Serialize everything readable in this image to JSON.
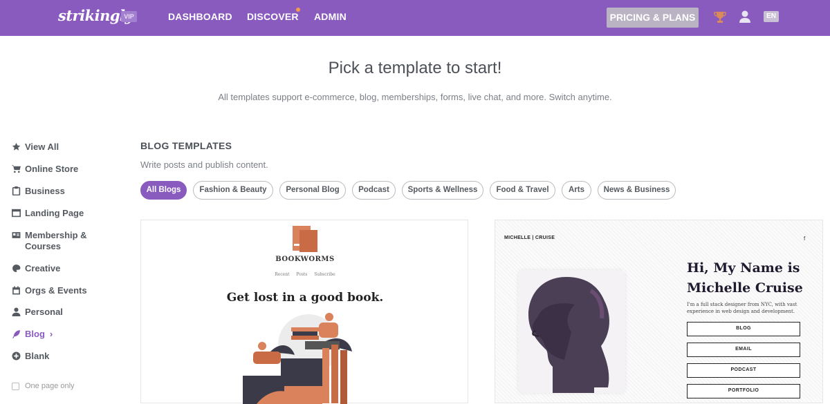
{
  "topbar": {
    "logo": "strikingly",
    "vip": "VIP",
    "nav": [
      "DASHBOARD",
      "DISCOVER",
      "ADMIN"
    ],
    "pricing": "PRICING & PLANS",
    "lang": "EN",
    "accent_color": "#8a5bbf"
  },
  "header": {
    "title": "Pick a template to start!",
    "subtitle": "All templates support e-commerce, blog, memberships, forms, live chat, and more. Switch anytime."
  },
  "sidebar": {
    "items": [
      {
        "label": "View All",
        "icon": "star-icon"
      },
      {
        "label": "Online Store",
        "icon": "cart-icon"
      },
      {
        "label": "Business",
        "icon": "clipboard-icon"
      },
      {
        "label": "Landing Page",
        "icon": "browser-icon"
      },
      {
        "label": "Membership & Courses",
        "icon": "id-card-icon"
      },
      {
        "label": "Creative",
        "icon": "palette-icon"
      },
      {
        "label": "Orgs & Events",
        "icon": "calendar-icon"
      },
      {
        "label": "Personal",
        "icon": "person-icon"
      },
      {
        "label": "Blog",
        "icon": "feather-icon",
        "active": true
      },
      {
        "label": "Blank",
        "icon": "plus-circle-icon"
      }
    ],
    "blog_chevron": "›",
    "one_page_only": "One page only"
  },
  "main": {
    "section_title": "BLOG TEMPLATES",
    "section_subtitle": "Write posts and publish content.",
    "filters": [
      "All Blogs",
      "Fashion & Beauty",
      "Personal Blog",
      "Podcast",
      "Sports & Wellness",
      "Food & Travel",
      "Arts",
      "News & Business"
    ],
    "active_filter": "All Blogs"
  },
  "cards": {
    "bookworms": {
      "name": "BOOKWORMS",
      "nav": "Recent Posts Subscribe",
      "tagline": "Get lost in a good book."
    },
    "michelle": {
      "brand": "MICHELLE | CRUISE",
      "social": "f",
      "heading_line1": "Hi, My Name is",
      "heading_line2": "Michelle Cruise",
      "description": "I'm a full stack designer from NYC, with vast experience in web design and development.",
      "buttons": [
        "BLOG",
        "EMAIL",
        "PODCAST",
        "PORTFOLIO"
      ]
    }
  }
}
